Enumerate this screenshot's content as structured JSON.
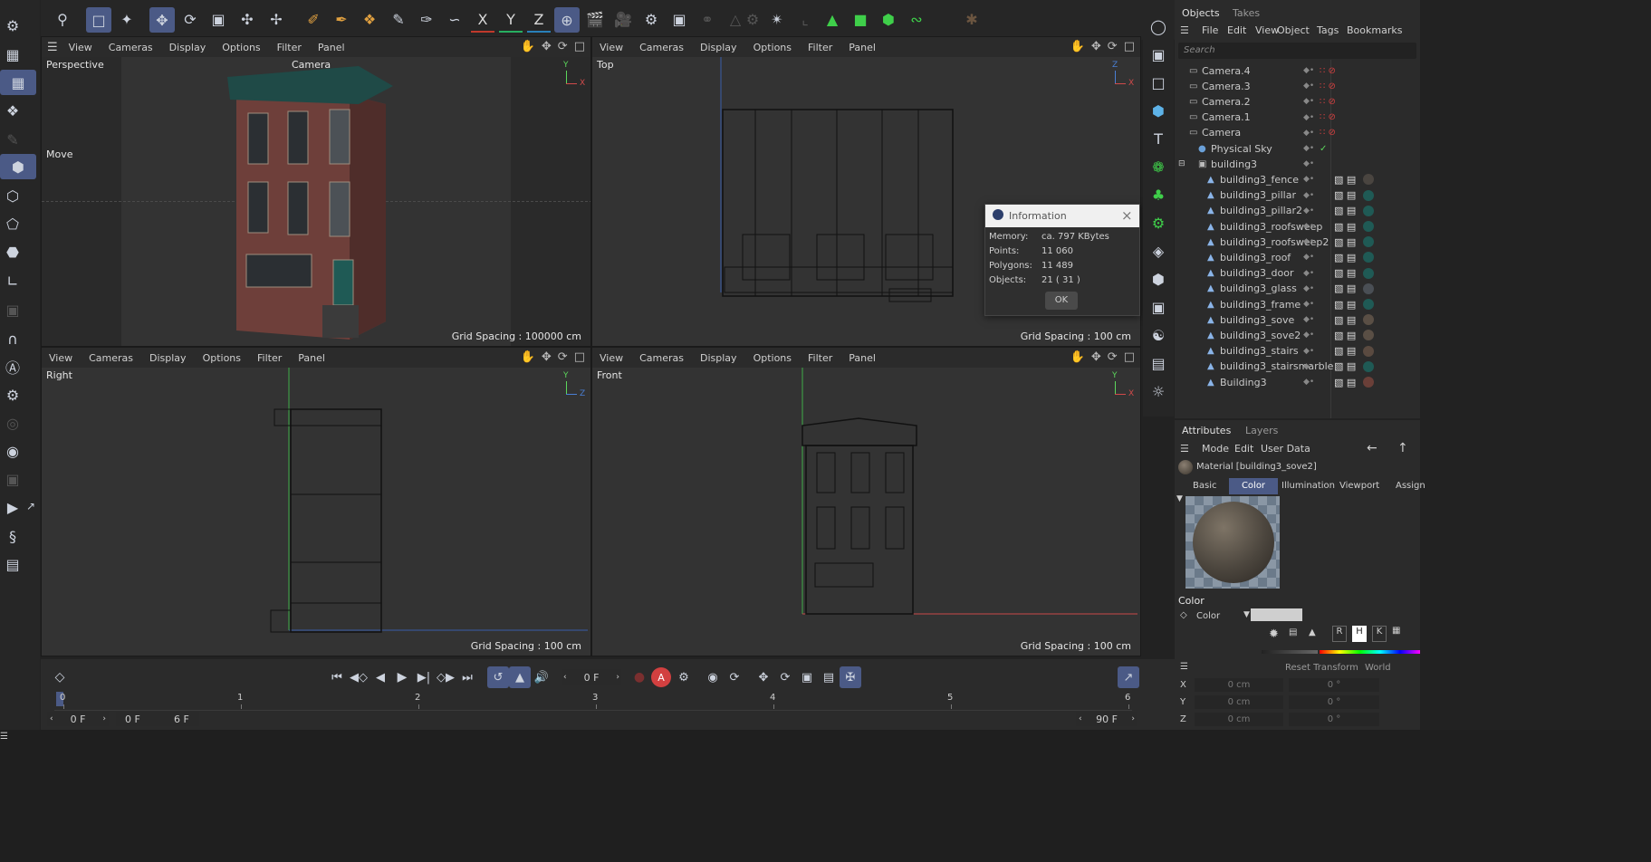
{
  "toolbar": {
    "axis_x": "X",
    "axis_y": "Y",
    "axis_z": "Z"
  },
  "viewports": {
    "menu": [
      "View",
      "Cameras",
      "Display",
      "Options",
      "Filter",
      "Panel"
    ],
    "perspective": {
      "name": "Perspective",
      "camera_label": "Camera",
      "grid": "Grid Spacing : 100000 cm",
      "tool_label": "Move"
    },
    "top": {
      "name": "Top",
      "grid": "Grid Spacing : 100 cm"
    },
    "right": {
      "name": "Right",
      "grid": "Grid Spacing : 100 cm"
    },
    "front": {
      "name": "Front",
      "grid": "Grid Spacing : 100 cm"
    }
  },
  "info_dialog": {
    "title": "Information",
    "rows": [
      {
        "label": "Memory:",
        "value": "ca. 797 KBytes"
      },
      {
        "label": "Points:",
        "value": "11 060"
      },
      {
        "label": "Polygons:",
        "value": "11 489"
      },
      {
        "label": "Objects:",
        "value": "21 ( 31 )"
      }
    ],
    "ok": "OK"
  },
  "objects_panel": {
    "tabs": [
      "Objects",
      "Takes"
    ],
    "menu": [
      "File",
      "Edit",
      "View",
      "Object",
      "Tags",
      "Bookmarks"
    ],
    "search_placeholder": "Search",
    "items": [
      {
        "name": "Camera.4"
      },
      {
        "name": "Camera.3"
      },
      {
        "name": "Camera.2"
      },
      {
        "name": "Camera.1"
      },
      {
        "name": "Camera"
      },
      {
        "name": "Physical Sky"
      },
      {
        "name": "building3"
      },
      {
        "name": "building3_fence"
      },
      {
        "name": "building3_pillar"
      },
      {
        "name": "building3_pillar2"
      },
      {
        "name": "building3_roofsweep"
      },
      {
        "name": "building3_roofsweep2"
      },
      {
        "name": "building3_roof"
      },
      {
        "name": "building3_door"
      },
      {
        "name": "building3_glass"
      },
      {
        "name": "building3_frame"
      },
      {
        "name": "building3_sove"
      },
      {
        "name": "building3_sove2"
      },
      {
        "name": "building3_stairs"
      },
      {
        "name": "building3_stairsmarble"
      },
      {
        "name": "Building3"
      }
    ]
  },
  "attributes_panel": {
    "tabs": [
      "Attributes",
      "Layers"
    ],
    "menu": [
      "Mode",
      "Edit",
      "User Data"
    ],
    "material_title": "Material [building3_sove2]",
    "subtabs": [
      "Basic",
      "Color",
      "Illumination",
      "Viewport",
      "Assign"
    ],
    "section": "Color",
    "color_label": "Color",
    "mode_buttons": [
      "R",
      "H",
      "K"
    ]
  },
  "coordinates": {
    "reset": "Reset Transform",
    "space": "World",
    "rows": [
      {
        "axis": "X",
        "pos": "0 cm",
        "rot": "0 °"
      },
      {
        "axis": "Y",
        "pos": "0 cm",
        "rot": "0 °"
      },
      {
        "axis": "Z",
        "pos": "0 cm",
        "rot": "0 °"
      }
    ]
  },
  "timeline": {
    "current_frame": "0 F",
    "ticks": [
      "0",
      "1",
      "2",
      "3",
      "4",
      "5",
      "6"
    ],
    "start_field": "0 F",
    "range_start": "0 F",
    "range_end": "6 F",
    "end_field": "90 F"
  }
}
